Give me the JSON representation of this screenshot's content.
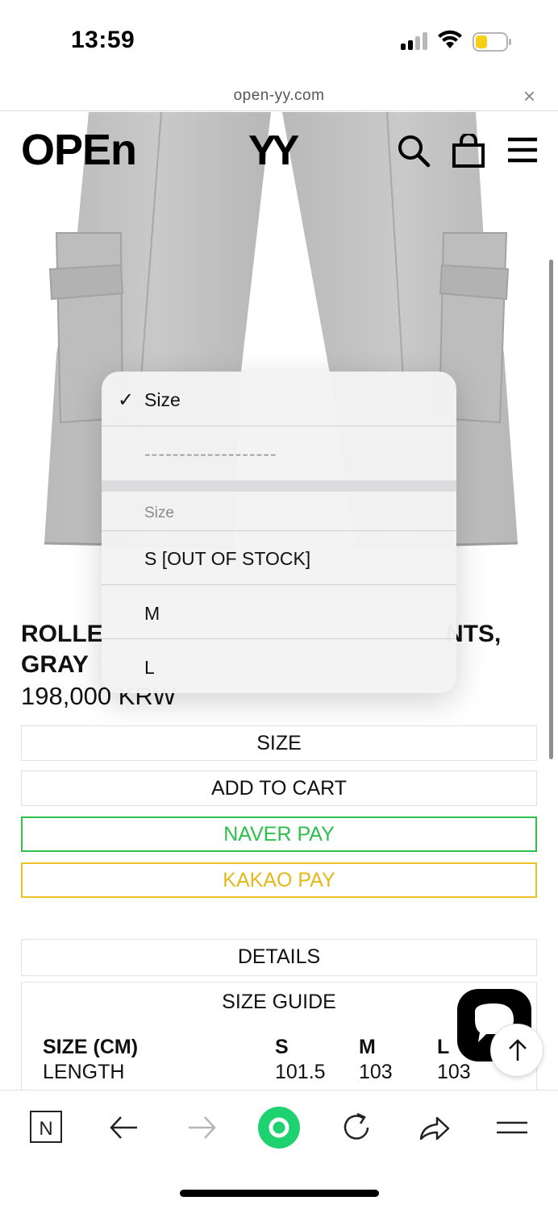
{
  "status_bar": {
    "time": "13:59"
  },
  "url_bar": {
    "url": "open-yy.com",
    "close_glyph": "×"
  },
  "header": {
    "logo_left": "OPEN",
    "logo_right": "YY",
    "icons": [
      "search-icon",
      "shopping-bag-icon",
      "menu-icon"
    ]
  },
  "product": {
    "title_line1": "ROLLE",
    "title_line1_end": "NTS,",
    "title_line2": "GRAY",
    "price": "198,000 KRW"
  },
  "buttons": {
    "size": "SIZE",
    "add_to_cart": "ADD TO CART",
    "naver_pay": "NAVER PAY",
    "kakao_pay": "KAKAO PAY",
    "details": "DETAILS"
  },
  "size_guide": {
    "title": "SIZE GUIDE",
    "header": [
      "SIZE (CM)",
      "S",
      "M",
      "L"
    ],
    "rows": [
      [
        "LENGTH",
        "101.5",
        "103",
        "103"
      ]
    ]
  },
  "size_picker": {
    "selected": "Size",
    "check_glyph": "✓",
    "separator": "-------------------",
    "group_header": "Size",
    "options": [
      "S [OUT OF STOCK]",
      "M",
      "L"
    ]
  },
  "toolbar": {
    "items": [
      "naver-home-icon",
      "back-arrow-icon",
      "forward-arrow-icon",
      "naver-green-dot-icon",
      "reload-icon",
      "share-icon",
      "menu-icon"
    ],
    "n_glyph": "N"
  },
  "colors": {
    "naver_green": "#2dc04c",
    "kakao_yellow": "#e3b818",
    "battery_yellow": "#f7cf17"
  }
}
